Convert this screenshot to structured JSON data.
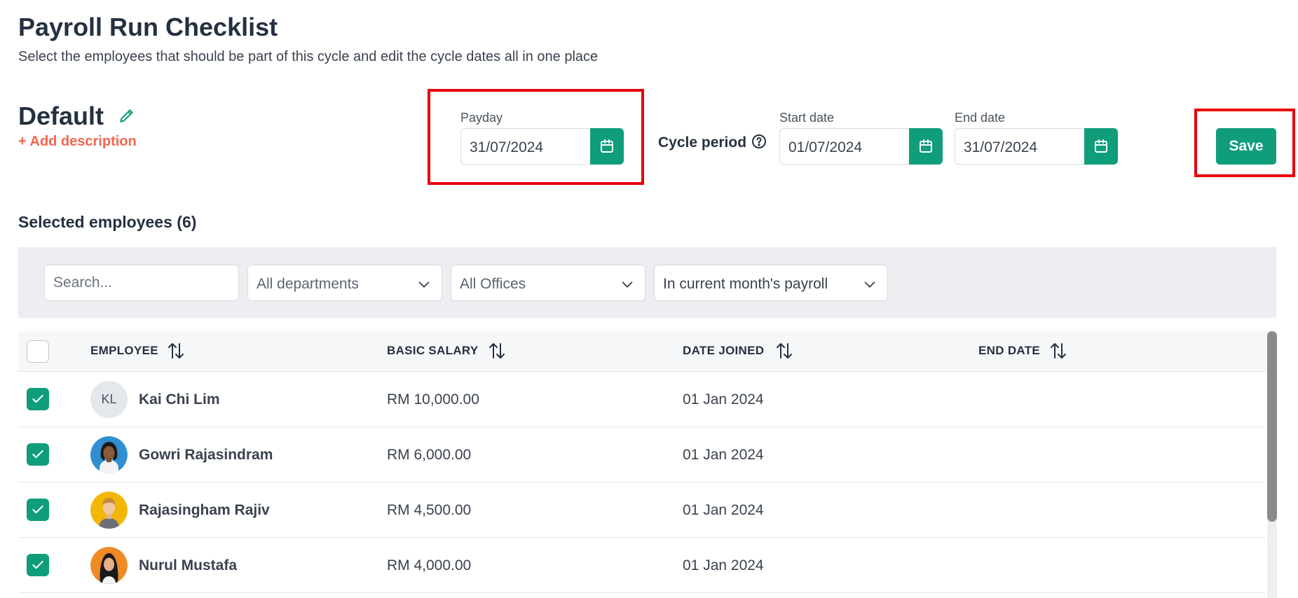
{
  "header": {
    "title": "Payroll Run Checklist",
    "subtitle": "Select the employees that should be part of this cycle and edit the cycle dates all in one place"
  },
  "cycle": {
    "name": "Default",
    "add_description": "+ Add description",
    "payday_label": "Payday",
    "payday_value": "31/07/2024",
    "cycle_period_label": "Cycle period",
    "start_label": "Start date",
    "start_value": "01/07/2024",
    "end_label": "End date",
    "end_value": "31/07/2024",
    "save_label": "Save"
  },
  "section": {
    "title": "Selected employees (6)"
  },
  "filters": {
    "search_placeholder": "Search...",
    "department": "All departments",
    "office": "All Offices",
    "payroll": "In current month's payroll"
  },
  "table": {
    "columns": [
      "EMPLOYEE",
      "BASIC SALARY",
      "DATE JOINED",
      "END DATE"
    ],
    "rows": [
      {
        "name": "Kai Chi Lim",
        "initials": "KL",
        "salary": "RM 10,000.00",
        "joined": "01 Jan 2024",
        "end": ""
      },
      {
        "name": "Gowri Rajasindram",
        "initials": "",
        "salary": "RM 6,000.00",
        "joined": "01 Jan 2024",
        "end": ""
      },
      {
        "name": "Rajasingham Rajiv",
        "initials": "",
        "salary": "RM 4,500.00",
        "joined": "01 Jan 2024",
        "end": ""
      },
      {
        "name": "Nurul Mustafa",
        "initials": "",
        "salary": "RM 4,000.00",
        "joined": "01 Jan 2024",
        "end": ""
      }
    ]
  },
  "colors": {
    "accent": "#0f9d7b",
    "link": "#f3664e",
    "highlight": "#e8000b"
  },
  "icons": [
    "edit-icon",
    "calendar-icon",
    "help-icon",
    "chevron-down-icon",
    "sort-icon",
    "check-icon"
  ]
}
